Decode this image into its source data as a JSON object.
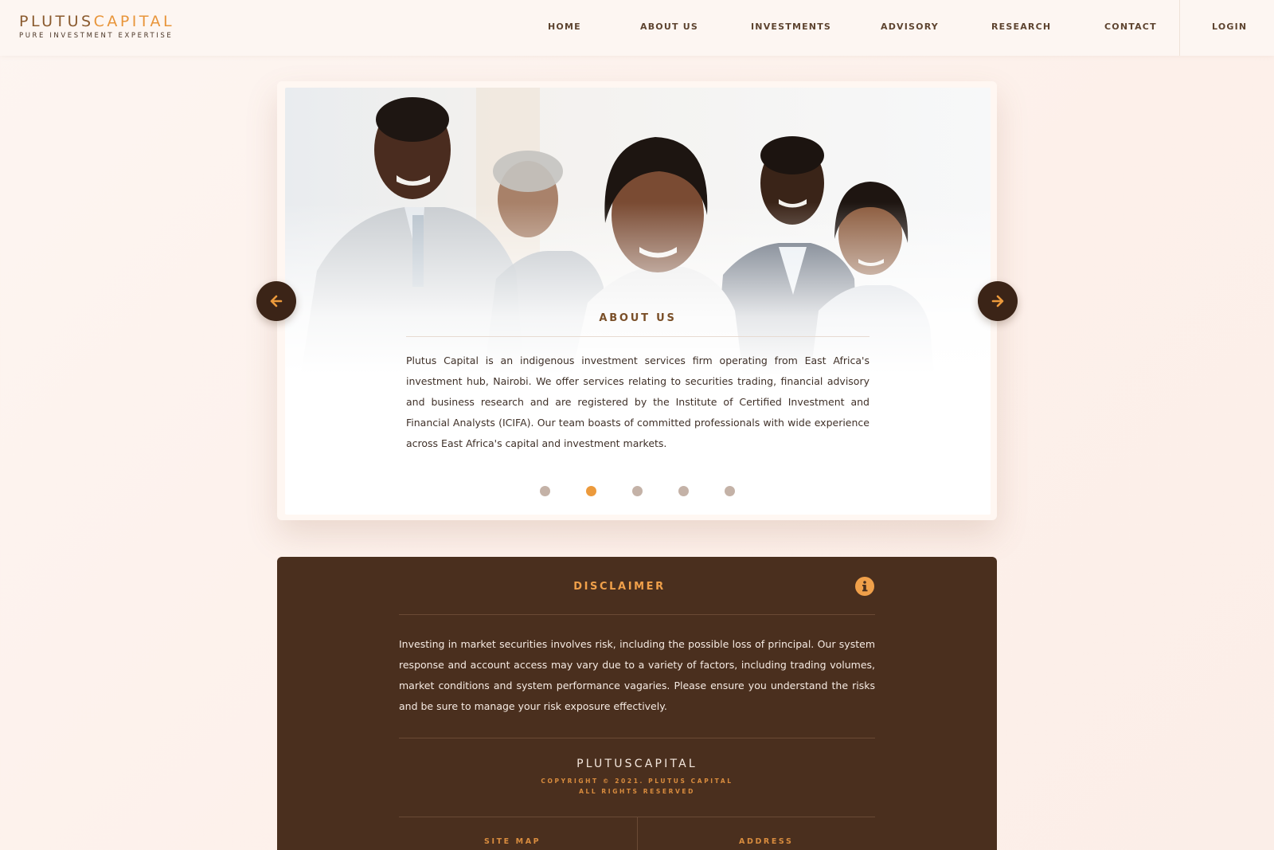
{
  "brand": {
    "name_part1": "PLUTUS",
    "name_part2": "CAPITAL",
    "tagline": "PURE INVESTMENT EXPERTISE"
  },
  "nav": {
    "items": [
      {
        "label": "HOME"
      },
      {
        "label": "ABOUT US"
      },
      {
        "label": "INVESTMENTS"
      },
      {
        "label": "ADVISORY"
      },
      {
        "label": "RESEARCH"
      },
      {
        "label": "CONTACT"
      }
    ],
    "login_label": "LOGIN"
  },
  "carousel": {
    "title": "ABOUT US",
    "body": "Plutus Capital is an indigenous investment services firm operating from East Africa's investment hub, Nairobi. We offer services relating to securities trading, financial advisory and business research and are registered by the Institute of Certified Investment and Financial Analysts (ICIFA). Our team boasts of committed professionals with wide experience across East Africa's capital and investment markets.",
    "slide_count": 5,
    "active_slide": 2,
    "prev_icon": "arrow-left-icon",
    "next_icon": "arrow-right-icon"
  },
  "disclaimer": {
    "title": "DISCLAIMER",
    "icon": "info-icon",
    "body": "Investing in market securities involves risk, including the possible loss of principal. Our system response and account access may vary due to a variety of factors, including trading volumes, market conditions and system performance vagaries. Please ensure you understand the risks and be sure to manage your risk exposure effectively."
  },
  "footer": {
    "logo_text": "PLUTUSCAPITAL",
    "copyright_line1": "COPYRIGHT © 2021. PLUTUS CAPITAL",
    "copyright_line2": "ALL RIGHTS RESERVED",
    "col1_heading": "SITE MAP",
    "col2_heading": "ADDRESS"
  },
  "colors": {
    "accent": "#ec9a3c",
    "brown_dark": "#4a2f1e",
    "brand_brown": "#8a5a2e"
  }
}
